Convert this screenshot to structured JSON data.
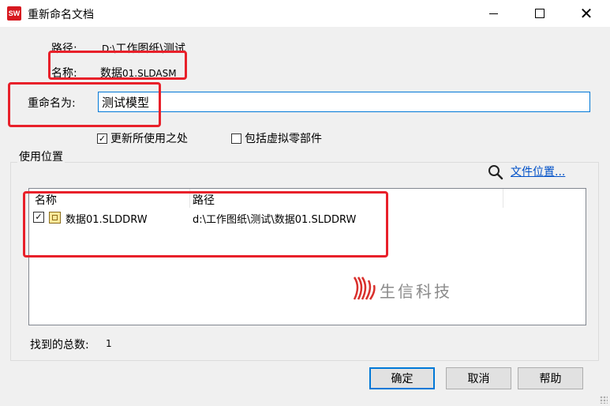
{
  "window": {
    "title": "重新命名文档",
    "icon_text": "SW"
  },
  "form": {
    "path_label": "路径:",
    "path_value": "D:\\工作图纸\\测试",
    "name_label": "名称:",
    "name_value": "数据",
    "name_suffix": "01.SLDASM",
    "rename_label": "重命名为:",
    "rename_value": "测试模型"
  },
  "options": {
    "update_usage": {
      "label": "更新所使用之处",
      "checked": true
    },
    "include_virtual": {
      "label": "包括虚拟零部件",
      "checked": false
    }
  },
  "usage": {
    "group_title": "使用位置",
    "file_location_link": "文件位置...",
    "columns": [
      "名称",
      "路径"
    ],
    "rows": [
      {
        "checked": true,
        "icon": "drawing-file-icon",
        "name": "数据01.SLDDRW",
        "path": "d:\\工作图纸\\测试\\数据01.SLDDRW"
      }
    ],
    "total_label": "找到的总数:",
    "total_value": "1"
  },
  "watermark": {
    "text": "生信科技"
  },
  "buttons": {
    "ok": "确定",
    "cancel": "取消",
    "help": "帮助"
  },
  "colors": {
    "highlight_box": "#e8202a",
    "link": "#0050c8",
    "focus": "#0078d7"
  }
}
